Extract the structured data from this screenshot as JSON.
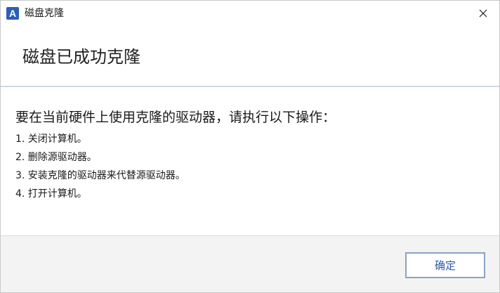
{
  "window": {
    "title": "磁盘克隆",
    "app_icon": {
      "name": "acronis-app-icon",
      "glyph": "A",
      "color": "#2c5fb8"
    },
    "close_icon": "close-icon"
  },
  "header": {
    "title": "磁盘已成功克隆"
  },
  "body": {
    "intro": "要在当前硬件上使用克隆的驱动器，请执行以下操作：",
    "steps": [
      "1. 关闭计算机。",
      "2. 删除源驱动器。",
      "3. 安装克隆的驱动器来代替源驱动器。",
      "4. 打开计算机。"
    ]
  },
  "footer": {
    "ok_label": "确定"
  },
  "colors": {
    "accent": "#2a5aa6",
    "button_border": "#8aa3c4",
    "divider": "#cfd8e4"
  }
}
